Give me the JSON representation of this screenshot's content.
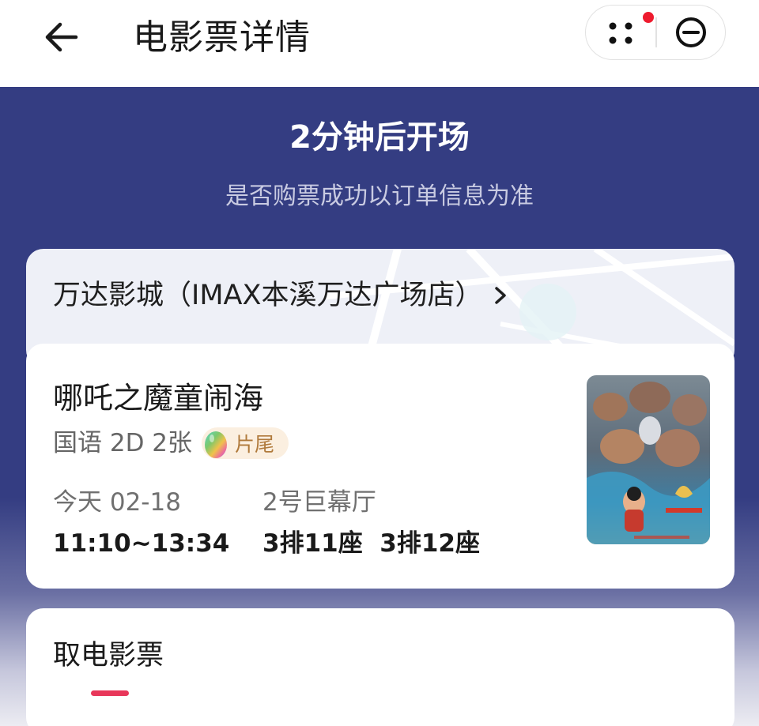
{
  "header": {
    "title": "电影票详情",
    "back_icon": "arrow-left-icon",
    "more_icon": "more-dots-icon",
    "close_icon": "minus-circle-icon"
  },
  "status": {
    "title": "2分钟后开场",
    "subtitle": "是否购票成功以订单信息为准"
  },
  "cinema": {
    "name": "万达影城（IMAX本溪万达广场店）",
    "chevron": "›"
  },
  "movie": {
    "title": "哪吒之魔童闹海",
    "meta": "国语 2D 2张",
    "tag": "片尾",
    "date": "今天 02-18",
    "time": "11:10~13:34",
    "hall": "2号巨幕厅",
    "seats": "3排11座  3排12座"
  },
  "ticket": {
    "title": "取电影票"
  },
  "colors": {
    "banner": "#343d82",
    "accent": "#e8375a",
    "badge": "#ee1b2e"
  }
}
